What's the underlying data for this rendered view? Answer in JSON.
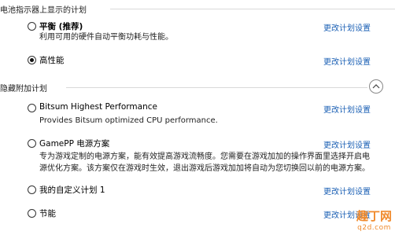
{
  "sections": {
    "battery_header": "电池指示器上显示的计划",
    "hidden_header": "隐藏附加计划"
  },
  "plans": [
    {
      "name": "平衡 (推荐)",
      "desc": "利用可用的硬件自动平衡功耗与性能。",
      "link": "更改计划设置",
      "checked": false
    },
    {
      "name": "高性能",
      "desc": "",
      "link": "更改计划设置",
      "checked": true
    },
    {
      "name": "Bitsum Highest Performance",
      "desc": "Provides Bitsum optimized CPU performance.",
      "link": "更改计划设置",
      "checked": false
    },
    {
      "name": "GamePP 电源方案",
      "desc": "专为游戏定制的电源方案，能有效提高游戏流畅度。您需要在游戏加加的操作界面里选择开启电源优化方案。该方案仅在游戏时生效，退出游戏后游戏加加将自动为您切换回以前的电源方案。",
      "link": "更改计划设置",
      "checked": false
    },
    {
      "name": "我的自定义计划 1",
      "desc": "",
      "link": "更改计划设置",
      "checked": false
    },
    {
      "name": "节能",
      "desc": "",
      "link": "更改计划设置",
      "checked": false
    }
  ],
  "watermark": {
    "logo": "趣丁网",
    "url": "q2d.com"
  },
  "colors": {
    "link": "#1a5fb4",
    "watermark": "#f08a2c"
  }
}
